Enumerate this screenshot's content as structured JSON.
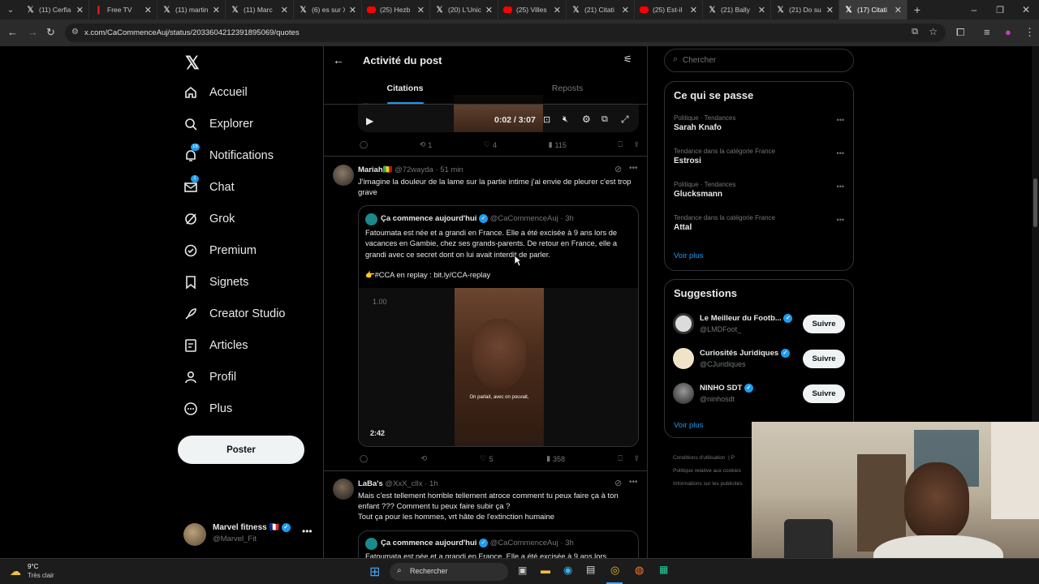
{
  "browser": {
    "tabs": [
      {
        "title": "(11) Cerfia",
        "icon": "x-logo",
        "active": false
      },
      {
        "title": "Free TV",
        "icon": "free-logo",
        "active": false
      },
      {
        "title": "(11) martin",
        "icon": "x-logo",
        "active": false
      },
      {
        "title": "(11) Marc",
        "icon": "x-logo",
        "active": false
      },
      {
        "title": "(6) es sur X",
        "icon": "x-logo",
        "active": false
      },
      {
        "title": "(25) Hezb",
        "icon": "youtube-logo",
        "active": false
      },
      {
        "title": "(20) L'Unic",
        "icon": "x-logo",
        "active": false
      },
      {
        "title": "(25) Villes",
        "icon": "youtube-logo",
        "active": false
      },
      {
        "title": "(21) Citati",
        "icon": "x-logo",
        "active": false
      },
      {
        "title": "(25) Est-il",
        "icon": "youtube-logo",
        "active": false
      },
      {
        "title": "(21) Bally",
        "icon": "x-logo",
        "active": false
      },
      {
        "title": "(21) Do su",
        "icon": "x-logo",
        "active": false
      },
      {
        "title": "(17) Citati",
        "icon": "x-logo",
        "active": true
      }
    ],
    "url": "x.com/CaCommenceAuj/status/2033604212391895069/quotes"
  },
  "nav": {
    "items": [
      {
        "label": "Accueil",
        "icon": "home-icon"
      },
      {
        "label": "Explorer",
        "icon": "search-icon"
      },
      {
        "label": "Notifications",
        "icon": "bell-icon",
        "badge": "18"
      },
      {
        "label": "Chat",
        "icon": "mail-icon",
        "badge": "1"
      },
      {
        "label": "Grok",
        "icon": "grok-icon"
      },
      {
        "label": "Premium",
        "icon": "premium-icon"
      },
      {
        "label": "Signets",
        "icon": "bookmark-icon"
      },
      {
        "label": "Creator Studio",
        "icon": "rocket-icon"
      },
      {
        "label": "Articles",
        "icon": "article-icon"
      },
      {
        "label": "Profil",
        "icon": "person-icon"
      },
      {
        "label": "Plus",
        "icon": "more-circle-icon"
      }
    ],
    "post_label": "Poster",
    "account": {
      "name": "Marvel fitness 🇫🇷",
      "handle": "@Marvel_Fit"
    }
  },
  "header": {
    "title": "Activité du post",
    "tabs": [
      "Citations",
      "Reposts"
    ]
  },
  "top_video": {
    "time": "0:02 / 3:07"
  },
  "top_actions": {
    "replies": "",
    "reposts": "1",
    "likes": "4",
    "views": "115"
  },
  "posts": [
    {
      "name": "Mariah🇲🇱",
      "handle": "@72wayda",
      "time": "51 min",
      "text": "J'imagine la douleur de la lame sur la partie intime j'ai envie de pleurer c'est trop grave",
      "quote": {
        "name": "Ça commence aujourd'hui",
        "handle": "@CaCommenceAuj",
        "time": "3h",
        "text": "Fatoumata est née et a grandi en France. Elle a été excisée à 9 ans lors de vacances en Gambie, chez ses grands-parents. De retour en France, elle a grandi avec ce secret dont on lui avait interdit de parler.",
        "link": "👉#CCA en replay : bit.ly/CCA-replay",
        "video_speed": "1.00",
        "video_duration": "2:42",
        "subtitle": "On parlait, avec on pouvait,"
      },
      "actions": {
        "replies": "",
        "reposts": "",
        "likes": "5",
        "views": "358"
      }
    },
    {
      "name": "LaBa's",
      "handle": "@XxX_cllx",
      "time": "1h",
      "text": "Mais c'est tellement horrible tellement atroce comment tu peux faire ça à ton enfant ??? Comment tu peux faire subir ça ?\nTout ça pour les hommes, vrt hâte de l'extinction humaine",
      "quote": {
        "name": "Ça commence aujourd'hui",
        "handle": "@CaCommenceAuj",
        "time": "3h",
        "text": "Fatoumata est née et a grandi en France. Elle a été excisée à 9 ans lors"
      }
    }
  ],
  "search": {
    "placeholder": "Chercher"
  },
  "trends": {
    "title": "Ce qui se passe",
    "items": [
      {
        "category": "Politique · Tendances",
        "name": "Sarah Knafo"
      },
      {
        "category": "Tendance dans la catégorie France",
        "name": "Estrosi"
      },
      {
        "category": "Politique · Tendances",
        "name": "Glucksmann"
      },
      {
        "category": "Tendance dans la catégorie France",
        "name": "Attal"
      }
    ],
    "more": "Voir plus"
  },
  "suggestions": {
    "title": "Suggestions",
    "items": [
      {
        "name": "Le Meilleur du Footb...",
        "handle": "@LMDFoot_",
        "button": "Suivre"
      },
      {
        "name": "Curiosités Juridiques",
        "handle": "@CJuridiques",
        "button": "Suivre"
      },
      {
        "name": "NINHO SDT",
        "handle": "@ninhosdt",
        "button": "Suivre"
      }
    ],
    "more": "Voir plus"
  },
  "footer": {
    "links": [
      "Conditions d'utilisation",
      "|",
      "P",
      "Politique relative aux cookies",
      "Informations sur les publicités"
    ]
  },
  "taskbar": {
    "weather_temp": "9°C",
    "weather_desc": "Très clair",
    "search": "Rechercher"
  },
  "colors": {
    "accent": "#1d9bf0",
    "background": "#000000",
    "border": "#2f3336",
    "muted": "#71767b"
  }
}
